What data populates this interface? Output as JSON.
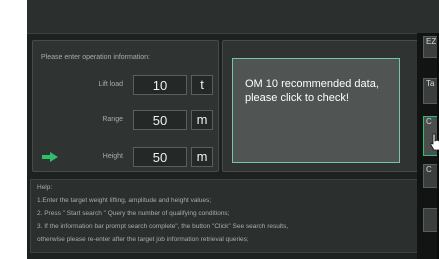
{
  "input_panel": {
    "title": "Please enter operation information:",
    "fields": [
      {
        "label": "Lift load",
        "value": "10",
        "unit": "t"
      },
      {
        "label": "Range",
        "value": "50",
        "unit": "m"
      },
      {
        "label": "Height",
        "value": "50",
        "unit": "m"
      }
    ]
  },
  "result": {
    "message": "OM 10 recommended data, please click to check!"
  },
  "help": {
    "title": "Help:",
    "lines": [
      "1.Enter the target weight lifting, amplitude and height values;",
      "2. Press \" Start search \" Query the number of qualifying conditions;",
      "3. If the information bar prompt search complete\", the button \"Click\" See search results,",
      "otherwise please re-enter after the target job information retrieval queries;"
    ]
  },
  "right_rail": {
    "buttons": [
      "EZ",
      "Ta",
      "C",
      "C"
    ]
  },
  "colors": {
    "accent_green": "#2fbf6c",
    "message_border": "#74c6a7",
    "background": "#1d2120"
  }
}
